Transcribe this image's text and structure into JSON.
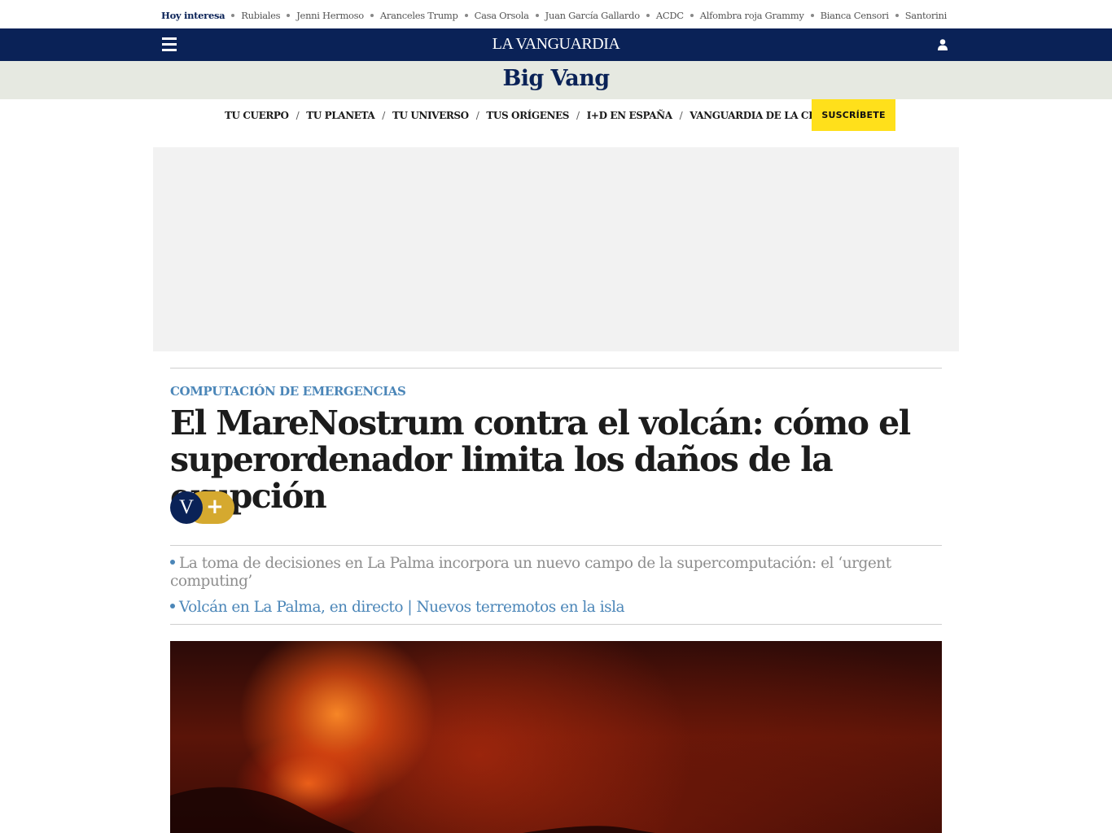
{
  "trending": {
    "label": "Hoy interesa",
    "tags": [
      "Rubiales",
      "Jenni Hermoso",
      "Aranceles Trump",
      "Casa Orsola",
      "Juan García Gallardo",
      "ACDC",
      "Alfombra roja Grammy",
      "Bianca Censori",
      "Santorini"
    ]
  },
  "header": {
    "logo": "LA VANGUARDIA",
    "menu_icon": "hamburger-menu-icon",
    "user_icon": "user-icon"
  },
  "section": {
    "title": "Big Vang"
  },
  "subnav": {
    "items": [
      "TU CUERPO",
      "TU PLANETA",
      "TU UNIVERSO",
      "TUS ORÍGENES",
      "I+D EN ESPAÑA",
      "VANGUARDIA DE LA CIENCIA"
    ],
    "separator": "/",
    "subscribe_label": "SUSCRÍBETE"
  },
  "article": {
    "kicker": "COMPUTACIÓN DE EMERGENCIAS",
    "headline": "El MareNostrum contra el volcán: cómo el superordenador limita los daños de la erupción",
    "badge": {
      "letter": "V",
      "plus": "+"
    },
    "related": [
      "La toma de decisiones en La Palma incorpora un nuevo campo de la supercomputación: el ‘urgent computing’",
      "Volcán en La Palma, en directo | Nuevos terremotos en la isla"
    ]
  },
  "colors": {
    "navy": "#0a2257",
    "accent_blue": "#4b86b8",
    "subscribe_yellow": "#ffe01b",
    "gold": "#d5a92f",
    "band": "#e6e9e1"
  }
}
